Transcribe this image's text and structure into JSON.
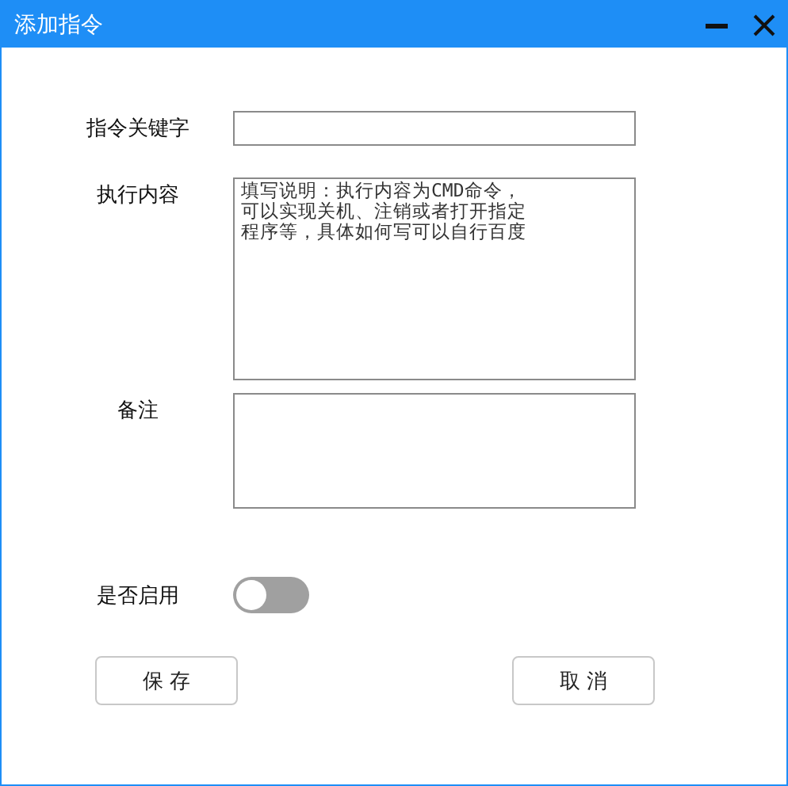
{
  "window": {
    "title": "添加指令"
  },
  "fields": [
    {
      "kind": "input",
      "label": "指令关键字"
    },
    {
      "kind": "textarea",
      "label": "执行内容",
      "placeholder": "填写说明：执行内容为CMD命令，可以实现关机、注销或者打开指定程序等，具体如何写可以自行百度"
    },
    {
      "kind": "textarea",
      "label": "备注"
    }
  ],
  "enabled_toggle": {
    "label": "是否启用",
    "on": false
  },
  "buttons": [
    "保 存",
    "取 消"
  ]
}
